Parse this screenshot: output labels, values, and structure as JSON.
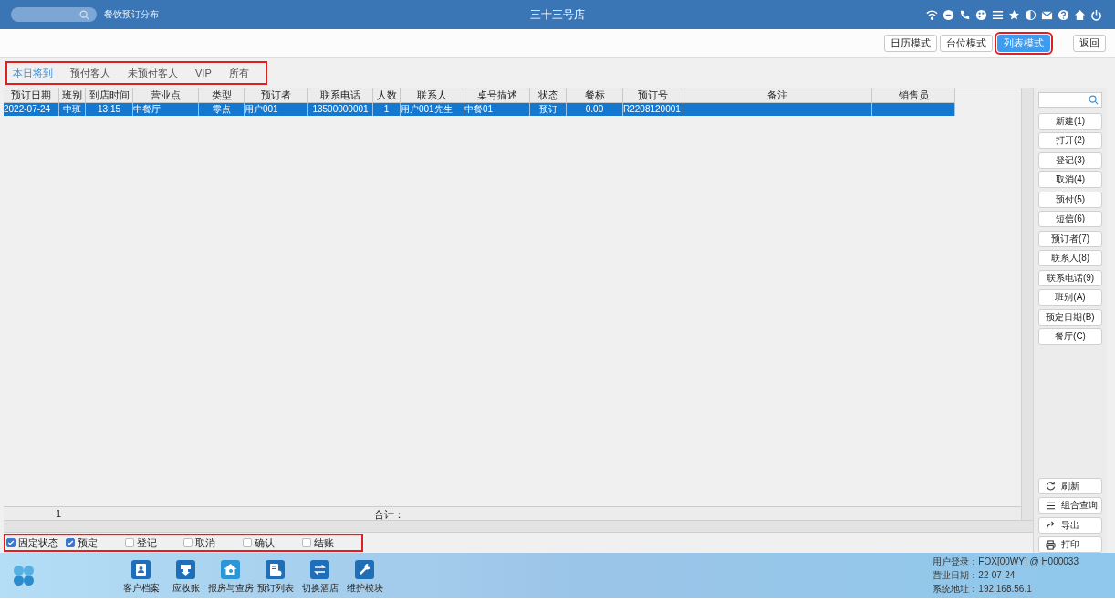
{
  "header": {
    "module_title": "餐饮预订分布",
    "store": "三十三号店"
  },
  "toolbar": {
    "modes": [
      {
        "label": "日历模式",
        "selected": false
      },
      {
        "label": "台位模式",
        "selected": false
      },
      {
        "label": "列表模式",
        "selected": true
      }
    ],
    "back": "返回"
  },
  "tabs": [
    {
      "label": "本日将到",
      "selected": true
    },
    {
      "label": "预付客人",
      "selected": false
    },
    {
      "label": "未预付客人",
      "selected": false
    },
    {
      "label": "VIP",
      "selected": false
    },
    {
      "label": "所有",
      "selected": false
    }
  ],
  "table": {
    "columns": [
      "预订日期",
      "班别",
      "到店时间",
      "营业点",
      "类型",
      "预订者",
      "联系电话",
      "人数",
      "联系人",
      "桌号描述",
      "状态",
      "餐标",
      "预订号",
      "备注",
      "销售员"
    ],
    "rows": [
      {
        "selected": true,
        "cells": [
          "2022-07-24",
          "中班",
          "13:15",
          "中餐厅",
          "零点",
          "用户001",
          "13500000001",
          "1",
          "用户001先生",
          "中餐01",
          "预订",
          "0.00",
          "R2208120001"
        ]
      }
    ],
    "footer": {
      "count": "1",
      "total_label": "合计："
    }
  },
  "status_filters": [
    {
      "label": "固定状态",
      "checked": true
    },
    {
      "label": "预定",
      "checked": true
    },
    {
      "label": "登记",
      "checked": false
    },
    {
      "label": "取消",
      "checked": false
    },
    {
      "label": "确认",
      "checked": false
    },
    {
      "label": "结账",
      "checked": false
    }
  ],
  "side_panel": {
    "actions": [
      "新建(1)",
      "打开(2)",
      "登记(3)",
      "取消(4)",
      "预付(5)",
      "短信(6)",
      "预订者(7)",
      "联系人(8)",
      "联系电话(9)",
      "班别(A)",
      "预定日期(B)",
      "餐厅(C)"
    ],
    "tools": [
      {
        "kind": "refresh",
        "label": "刷新"
      },
      {
        "kind": "query",
        "label": "组合查询"
      },
      {
        "kind": "export",
        "label": "导出"
      },
      {
        "kind": "print",
        "label": "打印"
      }
    ]
  },
  "dock": [
    {
      "kind": "customer",
      "label": "客户档案"
    },
    {
      "kind": "receivable",
      "label": "应收账"
    },
    {
      "kind": "rooms",
      "label": "报房与查房"
    },
    {
      "kind": "reservations",
      "label": "预订列表"
    },
    {
      "kind": "switch",
      "label": "切换酒店"
    },
    {
      "kind": "maintenance",
      "label": "维护模块"
    }
  ],
  "session": [
    "用户登录：FOX[00WY] @ H000033",
    "营业日期：22-07-24",
    "系统地址：192.168.56.1"
  ]
}
